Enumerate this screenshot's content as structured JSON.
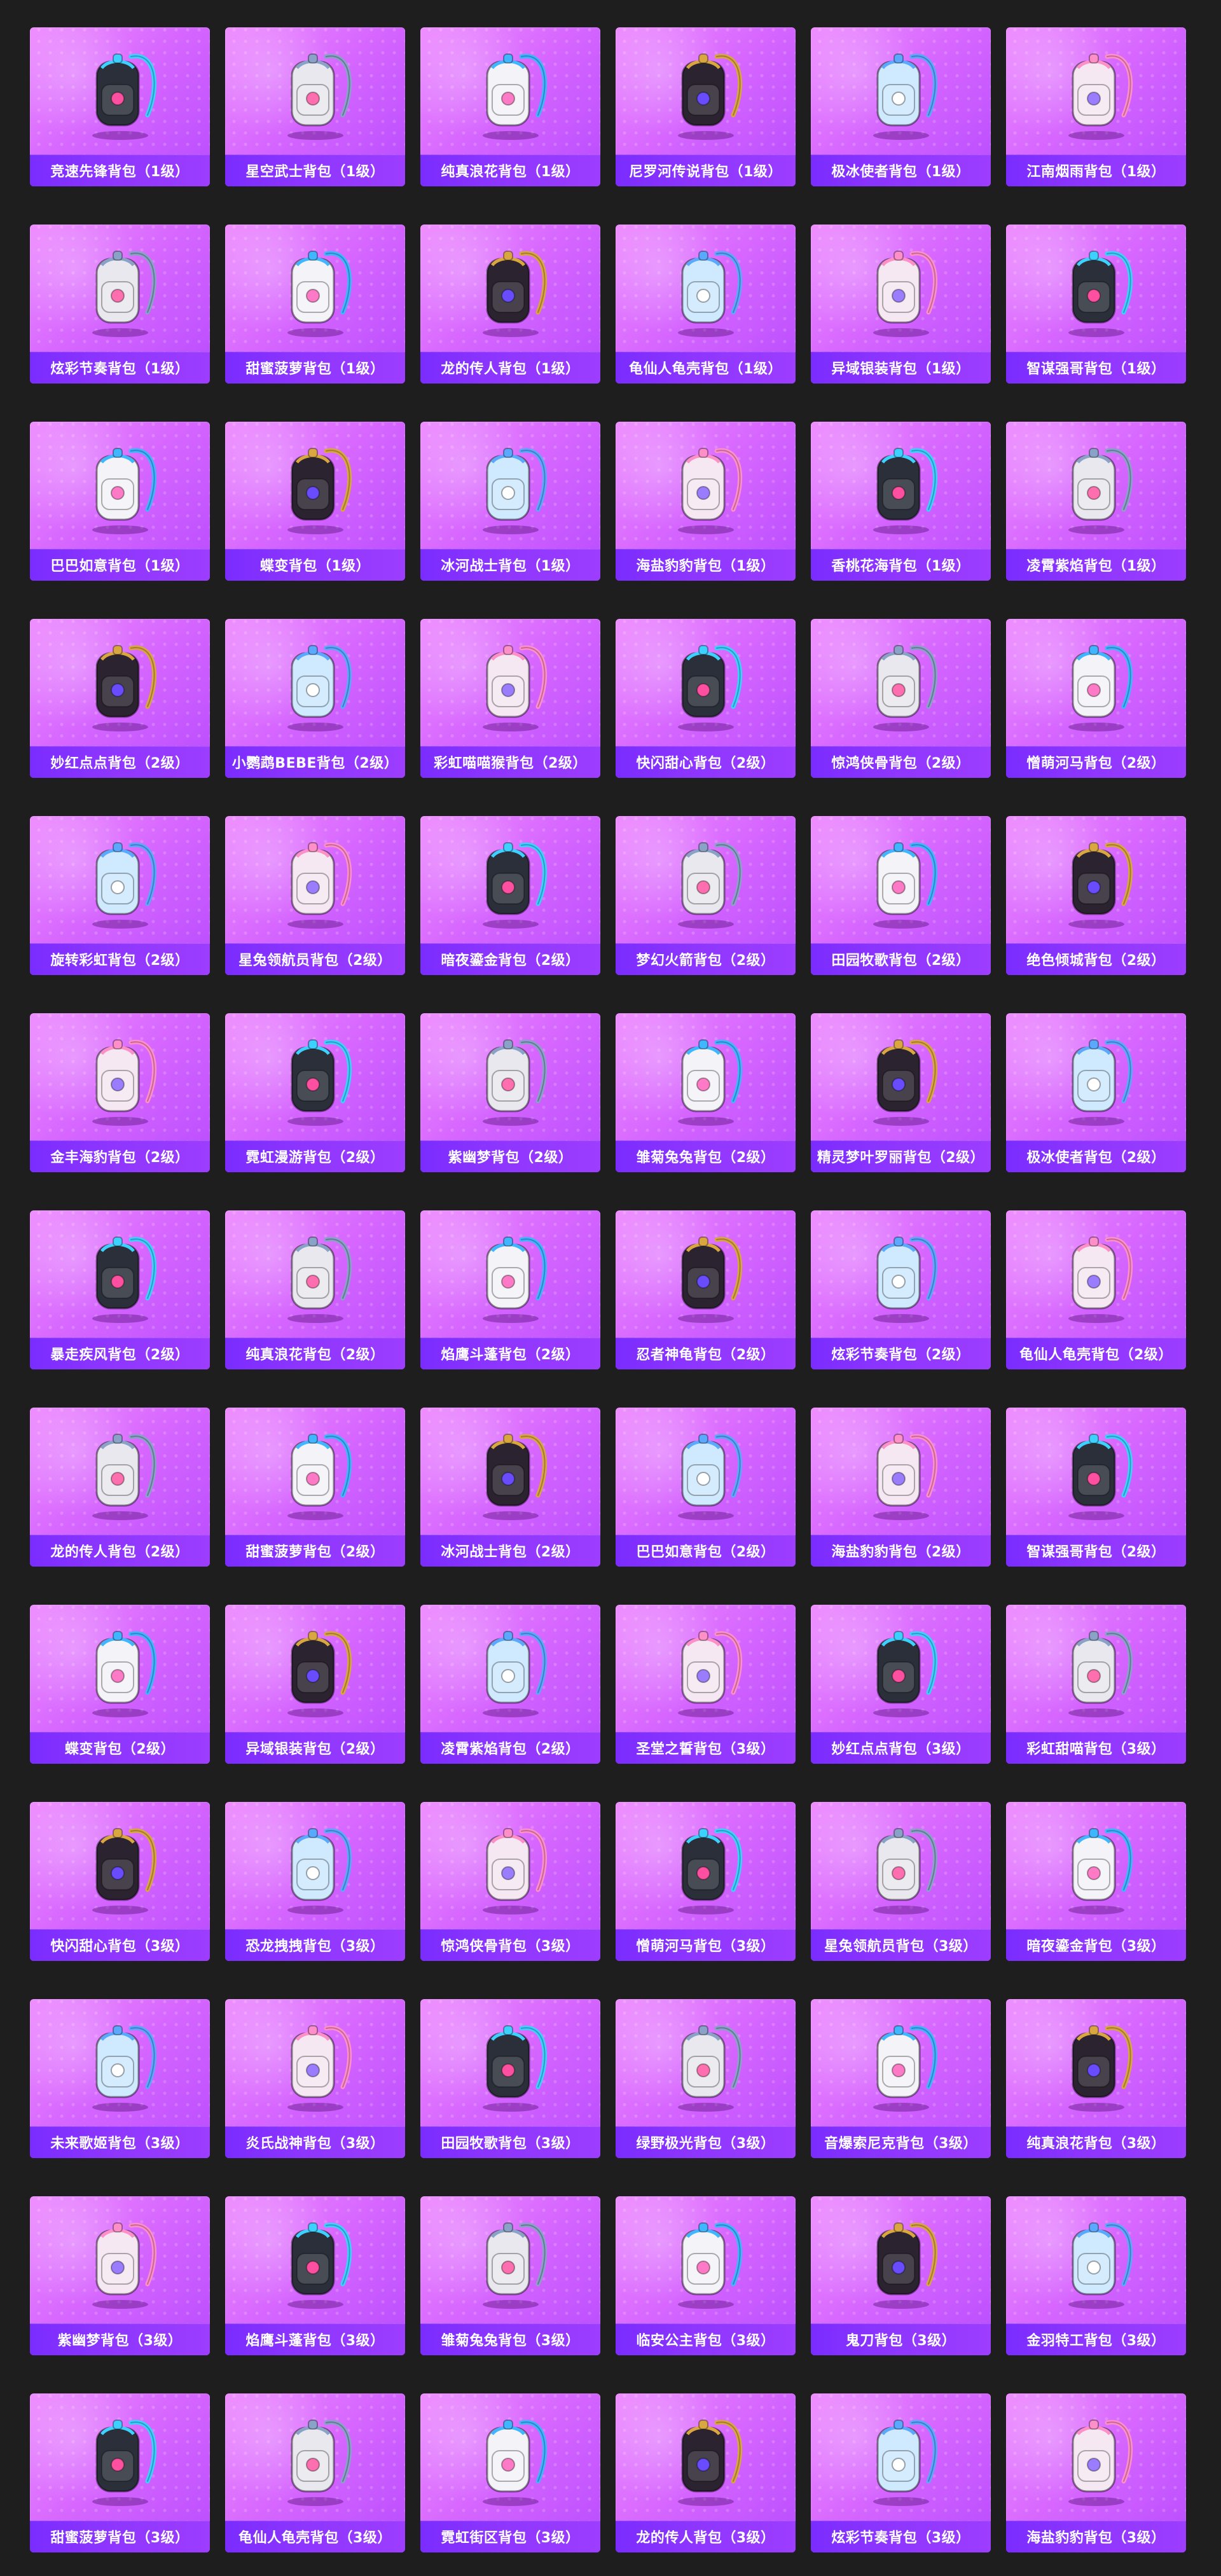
{
  "items": [
    {
      "name": "竞速先锋背包（1级）",
      "icon": "backpack-icon"
    },
    {
      "name": "星空武士背包（1级）",
      "icon": "backpack-icon"
    },
    {
      "name": "纯真浪花背包（1级）",
      "icon": "backpack-icon"
    },
    {
      "name": "尼罗河传说背包（1级）",
      "icon": "backpack-icon"
    },
    {
      "name": "极冰使者背包（1级）",
      "icon": "backpack-icon"
    },
    {
      "name": "江南烟雨背包（1级）",
      "icon": "backpack-icon"
    },
    {
      "name": "炫彩节奏背包（1级）",
      "icon": "backpack-icon"
    },
    {
      "name": "甜蜜菠萝背包（1级）",
      "icon": "backpack-icon"
    },
    {
      "name": "龙的传人背包（1级）",
      "icon": "backpack-icon"
    },
    {
      "name": "龟仙人龟壳背包（1级）",
      "icon": "backpack-icon"
    },
    {
      "name": "异域银装背包（1级）",
      "icon": "backpack-icon"
    },
    {
      "name": "智谋强哥背包（1级）",
      "icon": "backpack-icon"
    },
    {
      "name": "巴巴如意背包（1级）",
      "icon": "backpack-icon"
    },
    {
      "name": "蝶变背包（1级）",
      "icon": "backpack-icon"
    },
    {
      "name": "冰河战士背包（1级）",
      "icon": "backpack-icon"
    },
    {
      "name": "海盐豹豹背包（1级）",
      "icon": "backpack-icon"
    },
    {
      "name": "香桃花海背包（1级）",
      "icon": "backpack-icon"
    },
    {
      "name": "凌霄紫焰背包（1级）",
      "icon": "backpack-icon"
    },
    {
      "name": "妙红点点背包（2级）",
      "icon": "backpack-icon"
    },
    {
      "name": "小鹦鹉BEBE背包（2级）",
      "icon": "backpack-icon"
    },
    {
      "name": "彩虹喵喵猴背包（2级）",
      "icon": "backpack-icon"
    },
    {
      "name": "快闪甜心背包（2级）",
      "icon": "backpack-icon"
    },
    {
      "name": "惊鸿侠骨背包（2级）",
      "icon": "backpack-icon"
    },
    {
      "name": "憎萌河马背包（2级）",
      "icon": "backpack-icon"
    },
    {
      "name": "旋转彩虹背包（2级）",
      "icon": "backpack-icon"
    },
    {
      "name": "星兔领航员背包（2级）",
      "icon": "backpack-icon"
    },
    {
      "name": "暗夜鎏金背包（2级）",
      "icon": "backpack-icon"
    },
    {
      "name": "梦幻火箭背包（2级）",
      "icon": "backpack-icon"
    },
    {
      "name": "田园牧歌背包（2级）",
      "icon": "backpack-icon"
    },
    {
      "name": "绝色倾城背包（2级）",
      "icon": "backpack-icon"
    },
    {
      "name": "金丰海豹背包（2级）",
      "icon": "backpack-icon"
    },
    {
      "name": "霓虹漫游背包（2级）",
      "icon": "backpack-icon"
    },
    {
      "name": "紫幽梦背包（2级）",
      "icon": "backpack-icon"
    },
    {
      "name": "雏菊兔兔背包（2级）",
      "icon": "backpack-icon"
    },
    {
      "name": "精灵梦叶罗丽背包（2级）",
      "icon": "backpack-icon"
    },
    {
      "name": "极冰使者背包（2级）",
      "icon": "backpack-icon"
    },
    {
      "name": "暴走疾风背包（2级）",
      "icon": "backpack-icon"
    },
    {
      "name": "纯真浪花背包（2级）",
      "icon": "backpack-icon"
    },
    {
      "name": "焰鹰斗蓬背包（2级）",
      "icon": "backpack-icon"
    },
    {
      "name": "忍者神龟背包（2级）",
      "icon": "backpack-icon"
    },
    {
      "name": "炫彩节奏背包（2级）",
      "icon": "backpack-icon"
    },
    {
      "name": "龟仙人龟壳背包（2级）",
      "icon": "backpack-icon"
    },
    {
      "name": "龙的传人背包（2级）",
      "icon": "backpack-icon"
    },
    {
      "name": "甜蜜菠萝背包（2级）",
      "icon": "backpack-icon"
    },
    {
      "name": "冰河战士背包（2级）",
      "icon": "backpack-icon"
    },
    {
      "name": "巴巴如意背包（2级）",
      "icon": "backpack-icon"
    },
    {
      "name": "海盐豹豹背包（2级）",
      "icon": "backpack-icon"
    },
    {
      "name": "智谋强哥背包（2级）",
      "icon": "backpack-icon"
    },
    {
      "name": "蝶变背包（2级）",
      "icon": "backpack-icon"
    },
    {
      "name": "异域银装背包（2级）",
      "icon": "backpack-icon"
    },
    {
      "name": "凌霄紫焰背包（2级）",
      "icon": "backpack-icon"
    },
    {
      "name": "圣堂之誓背包（3级）",
      "icon": "backpack-icon"
    },
    {
      "name": "妙红点点背包（3级）",
      "icon": "backpack-icon"
    },
    {
      "name": "彩虹甜喵背包（3级）",
      "icon": "backpack-icon"
    },
    {
      "name": "快闪甜心背包（3级）",
      "icon": "backpack-icon"
    },
    {
      "name": "恐龙拽拽背包（3级）",
      "icon": "backpack-icon"
    },
    {
      "name": "惊鸿侠骨背包（3级）",
      "icon": "backpack-icon"
    },
    {
      "name": "憎萌河马背包（3级）",
      "icon": "backpack-icon"
    },
    {
      "name": "星兔领航员背包（3级）",
      "icon": "backpack-icon"
    },
    {
      "name": "暗夜鎏金背包（3级）",
      "icon": "backpack-icon"
    },
    {
      "name": "未来歌姬背包（3级）",
      "icon": "backpack-icon"
    },
    {
      "name": "炎氏战神背包（3级）",
      "icon": "backpack-icon"
    },
    {
      "name": "田园牧歌背包（3级）",
      "icon": "backpack-icon"
    },
    {
      "name": "绿野极光背包（3级）",
      "icon": "backpack-icon"
    },
    {
      "name": "音爆索尼克背包（3级）",
      "icon": "backpack-icon"
    },
    {
      "name": "纯真浪花背包（3级）",
      "icon": "backpack-icon"
    },
    {
      "name": "紫幽梦背包（3级）",
      "icon": "backpack-icon"
    },
    {
      "name": "焰鹰斗蓬背包（3级）",
      "icon": "backpack-icon"
    },
    {
      "name": "雏菊兔兔背包（3级）",
      "icon": "backpack-icon"
    },
    {
      "name": "临安公主背包（3级）",
      "icon": "backpack-icon"
    },
    {
      "name": "鬼刀背包（3级）",
      "icon": "backpack-icon"
    },
    {
      "name": "金羽特工背包（3级）",
      "icon": "backpack-icon"
    },
    {
      "name": "甜蜜菠萝背包（3级）",
      "icon": "backpack-icon"
    },
    {
      "name": "龟仙人龟壳背包（3级）",
      "icon": "backpack-icon"
    },
    {
      "name": "霓虹街区背包（3级）",
      "icon": "backpack-icon"
    },
    {
      "name": "龙的传人背包（3级）",
      "icon": "backpack-icon"
    },
    {
      "name": "炫彩节奏背包（3级）",
      "icon": "backpack-icon"
    },
    {
      "name": "海盐豹豹背包（3级）",
      "icon": "backpack-icon"
    }
  ],
  "colors": {
    "page_bg": "#1e1e1e",
    "card_gradient_start": "#ee8cff",
    "card_gradient_end": "#b84cff",
    "label_bar": "#8e36ff",
    "label_text": "#ffffff"
  }
}
